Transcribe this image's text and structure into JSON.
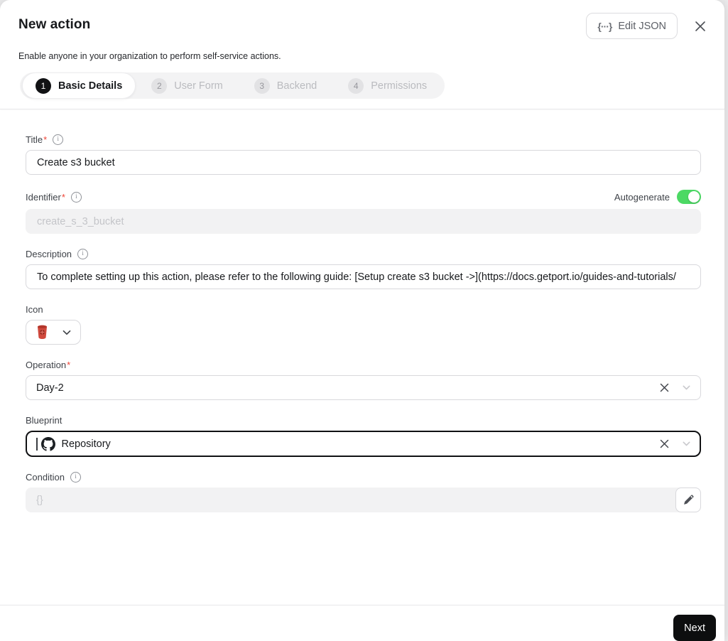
{
  "header": {
    "title": "New action",
    "subtitle": "Enable anyone in your organization to perform self-service actions.",
    "edit_json_label": "Edit JSON",
    "steps": [
      {
        "number": "1",
        "label": "Basic Details",
        "active": true
      },
      {
        "number": "2",
        "label": "User Form",
        "active": false
      },
      {
        "number": "3",
        "label": "Backend",
        "active": false
      },
      {
        "number": "4",
        "label": "Permissions",
        "active": false
      }
    ]
  },
  "form": {
    "title": {
      "label": "Title",
      "required": "*",
      "value": "Create s3 bucket"
    },
    "identifier": {
      "label": "Identifier",
      "required": "*",
      "value": "create_s_3_bucket",
      "autogenerate_label": "Autogenerate",
      "autogenerate_state": "on"
    },
    "description": {
      "label": "Description",
      "value": "To complete setting up this action, please refer to the following guide: [Setup create s3 bucket ->](https://docs.getport.io/guides-and-tutorials/"
    },
    "icon": {
      "label": "Icon",
      "selected_icon": "aws-s3-bucket-icon"
    },
    "operation": {
      "label": "Operation",
      "required": "*",
      "value": "Day-2"
    },
    "blueprint": {
      "label": "Blueprint",
      "value": "Repository",
      "value_icon": "github-icon"
    },
    "condition": {
      "label": "Condition",
      "placeholder": "{}"
    }
  },
  "footer": {
    "next_label": "Next"
  },
  "icons": {
    "edit_json_glyph": "{···}",
    "info_glyph": "i"
  },
  "colors": {
    "toggle_on": "#4cd964",
    "accent_dark": "#0d0e0f",
    "danger": "#ee4436",
    "s3_red": "#c8372c"
  }
}
